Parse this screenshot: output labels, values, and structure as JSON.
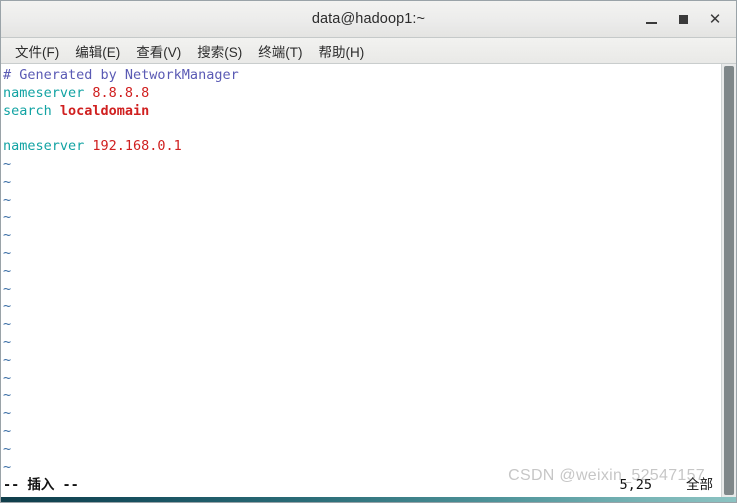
{
  "window": {
    "title": "data@hadoop1:~",
    "controls": [
      {
        "name": "minimize-button",
        "label": "_"
      },
      {
        "name": "maximize-button",
        "label": "□"
      },
      {
        "name": "close-button",
        "label": "✕"
      }
    ]
  },
  "menubar": {
    "items": [
      {
        "label": "文件(F)"
      },
      {
        "label": "编辑(E)"
      },
      {
        "label": "查看(V)"
      },
      {
        "label": "搜索(S)"
      },
      {
        "label": "终端(T)"
      },
      {
        "label": "帮助(H)"
      }
    ]
  },
  "terminal": {
    "lines": [
      {
        "type": "comment",
        "text": "# Generated by NetworkManager"
      },
      {
        "type": "kv",
        "key": "nameserver",
        "value": "8.8.8.8"
      },
      {
        "type": "kv-bold",
        "key": "search",
        "value": "localdomain"
      },
      {
        "type": "blank",
        "text": ""
      },
      {
        "type": "kv",
        "key": "nameserver",
        "value": "192.168.0.1"
      }
    ],
    "tilde": "~",
    "tilde_count": 19
  },
  "statusline": {
    "mode": "-- 插入 --",
    "position": "5,25",
    "scroll": "全部"
  },
  "watermark": {
    "text": "CSDN @weixin_52547157"
  },
  "colors": {
    "comment": "#5a5ab4",
    "keyword": "#12a3a3",
    "value": "#d02020",
    "tilde": "#3b6ea5",
    "background": "#ffffff",
    "titlebar": "#ececea",
    "scrollbar_thumb": "#7f8789"
  }
}
